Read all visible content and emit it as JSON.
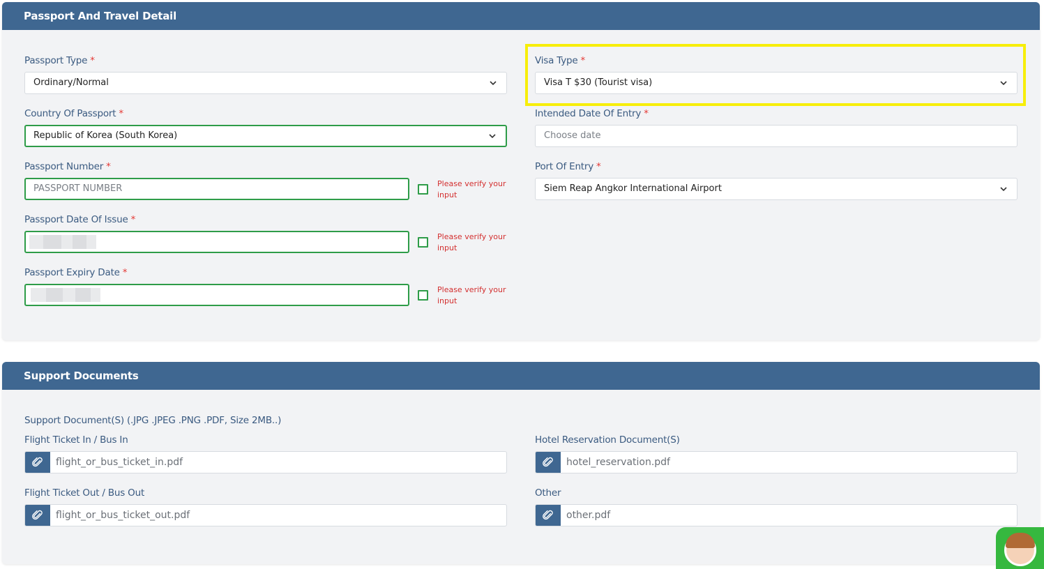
{
  "sections": {
    "passport_title": "Passport And Travel Detail",
    "support_title": "Support Documents"
  },
  "passport": {
    "type_label": "Passport Type",
    "type_value": "Ordinary/Normal",
    "country_label": "Country Of Passport",
    "country_value": "Republic of Korea (South Korea)",
    "number_label": "Passport Number",
    "number_placeholder": "PASSPORT NUMBER",
    "issue_label": "Passport Date Of Issue",
    "expiry_label": "Passport Expiry Date",
    "verify_text": "Please verify your input",
    "required_mark": "*"
  },
  "travel": {
    "visa_label": "Visa Type",
    "visa_value": "Visa T $30 (Tourist visa)",
    "entry_date_label": "Intended Date Of Entry",
    "entry_date_placeholder": "Choose date",
    "port_label": "Port Of Entry",
    "port_value": "Siem Reap Angkor International Airport"
  },
  "documents": {
    "hint": "Support Document(S) (.JPG .JPEG .PNG .PDF, Size 2MB..)",
    "flight_in_label": "Flight Ticket In / Bus In",
    "flight_in_file": "flight_or_bus_ticket_in.pdf",
    "hotel_label": "Hotel Reservation Document(S)",
    "hotel_file": "hotel_reservation.pdf",
    "flight_out_label": "Flight Ticket Out / Bus Out",
    "flight_out_file": "flight_or_bus_ticket_out.pdf",
    "other_label": "Other",
    "other_file": "other.pdf"
  },
  "colors": {
    "header": "#3f6791",
    "valid_border": "#2e9c48",
    "error_text": "#d32f2f",
    "highlight": "#f7ee0a"
  },
  "icons": [
    "chevron-down-icon",
    "paperclip-icon",
    "checkbox-icon",
    "support-avatar"
  ]
}
